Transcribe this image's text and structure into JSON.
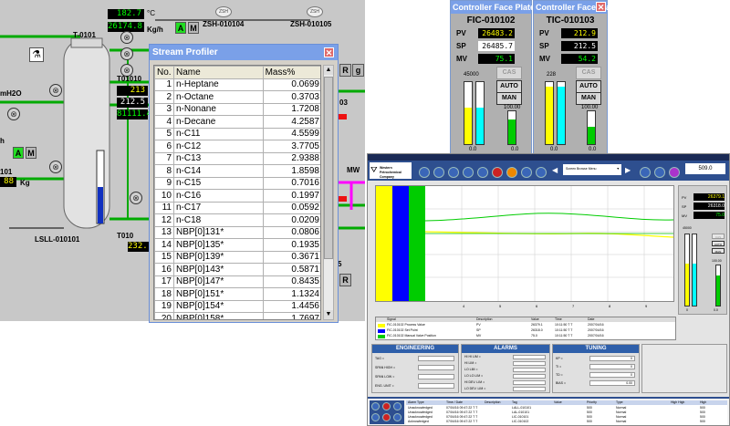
{
  "schematic": {
    "readouts": {
      "r1": "182.7",
      "r1_unit": "°C",
      "r2": "26174.8",
      "r2_unit": "Kg/h",
      "t_a": "213",
      "t_b": "212.5",
      "t_c": "81111.4",
      "kg_val": "88",
      "kg_unit": "Kg",
      "bottom_val": "232."
    },
    "labels": {
      "tower": "T-0101",
      "t_tag": "T01010",
      "zsh1": "ZSH-010104",
      "zsh2": "ZSH-010105",
      "mh2o": "mH2O",
      "lsll": "LSLL-010101",
      "tag101": "101",
      "t2": "T010",
      "n103": "03",
      "mw": "MW",
      "n5": "5",
      "r_btn": "R",
      "r_btn2": "R",
      "g_btn": "g",
      "a_btn": "A",
      "m_btn": "M",
      "a_btn2": "A",
      "m_btn2": "M",
      "h_lbl": "h",
      "zsh_badge": "ZSH"
    }
  },
  "profiler": {
    "title": "Stream Profiler",
    "columns": [
      "No.",
      "Name",
      "Mass%"
    ],
    "rows": [
      {
        "no": "1",
        "name": "n-Heptane",
        "mass": "0.0699"
      },
      {
        "no": "2",
        "name": "n-Octane",
        "mass": "0.3703"
      },
      {
        "no": "3",
        "name": "n-Nonane",
        "mass": "1.7208"
      },
      {
        "no": "4",
        "name": "n-Decane",
        "mass": "4.2587"
      },
      {
        "no": "5",
        "name": "n-C11",
        "mass": "4.5599"
      },
      {
        "no": "6",
        "name": "n-C12",
        "mass": "3.7705"
      },
      {
        "no": "7",
        "name": "n-C13",
        "mass": "2.9388"
      },
      {
        "no": "8",
        "name": "n-C14",
        "mass": "1.8598"
      },
      {
        "no": "9",
        "name": "n-C15",
        "mass": "0.7016"
      },
      {
        "no": "10",
        "name": "n-C16",
        "mass": "0.1997"
      },
      {
        "no": "11",
        "name": "n-C17",
        "mass": "0.0592"
      },
      {
        "no": "12",
        "name": "n-C18",
        "mass": "0.0209"
      },
      {
        "no": "13",
        "name": "NBP[0]131*",
        "mass": "0.0806"
      },
      {
        "no": "14",
        "name": "NBP[0]135*",
        "mass": "0.1935"
      },
      {
        "no": "15",
        "name": "NBP[0]139*",
        "mass": "0.3671"
      },
      {
        "no": "16",
        "name": "NBP[0]143*",
        "mass": "0.5871"
      },
      {
        "no": "17",
        "name": "NBP[0]147*",
        "mass": "0.8435"
      },
      {
        "no": "18",
        "name": "NBP[0]151*",
        "mass": "1.1324"
      },
      {
        "no": "19",
        "name": "NBP[0]154*",
        "mass": "1.4456"
      },
      {
        "no": "20",
        "name": "NBP[0]158*",
        "mass": "1.7697"
      }
    ]
  },
  "faceplate1": {
    "title": "Controller Face Plate",
    "tag": "FIC-010102",
    "pv_label": "PV",
    "pv": "26483.2",
    "sp_label": "SP",
    "sp": "26485.7",
    "mv_label": "MV",
    "mv": "75.1",
    "cas": "CAS",
    "auto": "AUTO",
    "man": "MAN",
    "scale_hi": "45000",
    "scale_lo": "0.0",
    "mv_hi": "100.00",
    "mv_lo": "0.0",
    "pv_fill": 0.59,
    "sp_fill": 0.59,
    "mv_fill": 0.75
  },
  "faceplate2": {
    "title": "Controller Face Plate",
    "tag": "TIC-010103",
    "pv_label": "PV",
    "pv": "212.9",
    "sp_label": "SP",
    "sp": "212.5",
    "mv_label": "MV",
    "mv": "54.2",
    "cas": "CAS",
    "auto": "AUTO",
    "man": "MAN",
    "scale_hi": "228",
    "scale_lo": "0.0",
    "mv_hi": "100.00",
    "mv_lo": "0.0",
    "pv_fill": 0.93,
    "sp_fill": 0.93,
    "mv_fill": 0.54
  },
  "trend": {
    "company": "Western Petrochemical Company",
    "search_box": "Screen Browse Menu",
    "value_box": "509.0",
    "pv_label": "PV",
    "pv": "26379.1",
    "sp_label": "SP",
    "sp": "26318.0",
    "mv_label": "MV",
    "mv": "75.0",
    "x_ticks": [
      "4",
      "5",
      "6",
      "7",
      "8",
      "9"
    ],
    "side_scale_hi": "45000",
    "side_scale_lo": "0",
    "side_mv_hi": "100.00",
    "side_mv_lo": "0.0",
    "man": "MAN",
    "auto": "AUTO",
    "cas": "CAS",
    "legend": {
      "headers": [
        "Signal",
        "Description",
        "Value",
        "Time",
        "Date"
      ],
      "rows": [
        {
          "signal": "FIC-010102 Process Value",
          "desc": "PV",
          "value": "26379.1",
          "time": "10:11:50 T T",
          "date": "2007/04/16",
          "color": "#ffff00"
        },
        {
          "signal": "FIC-010102 Set Point",
          "desc": "SP",
          "value": "26318.0",
          "time": "10:11:50 T T",
          "date": "2007/04/16",
          "color": "#0000ff"
        },
        {
          "signal": "FIC-010102 Manual Valve Position",
          "desc": "MV",
          "value": "75.0",
          "time": "10:11:50 T T",
          "date": "2007/04/16",
          "color": "#00cc00"
        }
      ]
    },
    "engineering": {
      "title": "ENGINEERING",
      "fields": [
        "TAG =",
        "SPAN HIGH =",
        "SPAN LOW =",
        "ENG. UNIT ="
      ]
    },
    "alarms": {
      "title": "ALARMS",
      "fields": [
        "HI HI LIM =",
        "HI LIM =",
        "LO LIM =",
        "LO LO LIM =",
        "HI DEV. LIM =",
        "LO DEV. LIM ="
      ]
    },
    "tuning": {
      "title": "TUNING",
      "fields": [
        {
          "label": "KP =",
          "value": "0"
        },
        {
          "label": "TI =",
          "value": "0"
        },
        {
          "label": "TD =",
          "value": "0"
        },
        {
          "label": "BIAS =",
          "value": "0.00"
        }
      ]
    },
    "alarm_table": {
      "headers": [
        "Alarm Type",
        "Time / Date",
        "Description",
        "Tag",
        "Value",
        "Priority",
        "Type",
        "High High",
        "High"
      ],
      "rows": [
        [
          "Unacknowledged",
          "07/04/16 09:47:22 T T",
          "",
          "LALL-010101",
          "",
          "500",
          "Normal",
          "",
          "500"
        ],
        [
          "Unacknowledged",
          "07/04/16 09:47:22 T T",
          "",
          "LAL-010101",
          "",
          "500",
          "Normal",
          "",
          "500"
        ],
        [
          "Unacknowledged",
          "07/04/16 09:47:22 T T",
          "",
          "LIC-010101",
          "",
          "500",
          "Normal",
          "",
          "500"
        ],
        [
          "Acknowledged",
          "07/04/16 09:47:22 T T",
          "",
          "LIC-010102",
          "",
          "500",
          "Normal",
          "",
          "500"
        ]
      ]
    }
  },
  "colors": {
    "schematic_bg": "#c8c8c8",
    "titlebar": "#7aa0e8",
    "pv_color": "#ffff00",
    "sp_color": "#0000ff",
    "mv_color": "#00cc00",
    "trend_toolbar": "#2e4f8f"
  }
}
